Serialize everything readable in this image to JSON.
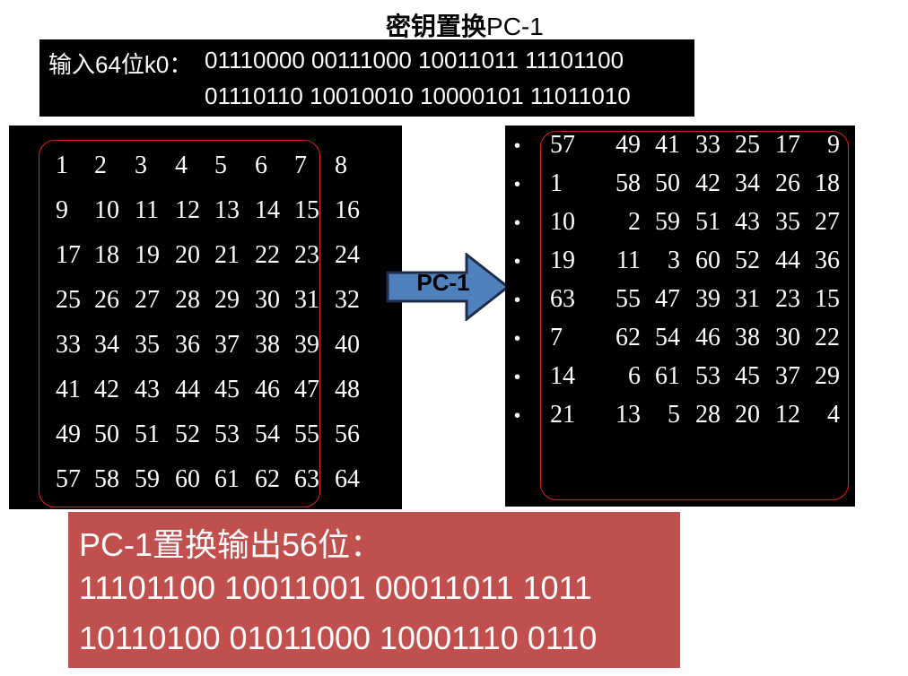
{
  "title": {
    "main": "密钥置换",
    "suffix": "PC-1"
  },
  "input": {
    "label": "输入64位k0：",
    "line1": "01110000 00111000 10011011 11101100",
    "line2": "01110110 10010010 10000101 11011010"
  },
  "left_table": {
    "rows": [
      [
        "1",
        "2",
        "3",
        "4",
        "5",
        "6",
        "7",
        "8"
      ],
      [
        "9",
        "10",
        "11",
        "12",
        "13",
        "14",
        "15",
        "16"
      ],
      [
        "17",
        "18",
        "19",
        "20",
        "21",
        "22",
        "23",
        "24"
      ],
      [
        "25",
        "26",
        "27",
        "28",
        "29",
        "30",
        "31",
        "32"
      ],
      [
        "33",
        "34",
        "35",
        "36",
        "37",
        "38",
        "39",
        "40"
      ],
      [
        "41",
        "42",
        "43",
        "44",
        "45",
        "46",
        "47",
        "48"
      ],
      [
        "49",
        "50",
        "51",
        "52",
        "53",
        "54",
        "55",
        "56"
      ],
      [
        "57",
        "58",
        "59",
        "60",
        "61",
        "62",
        "63",
        "64"
      ]
    ]
  },
  "arrow": {
    "label": "PC-1",
    "color": "#4f81bd"
  },
  "right_table": {
    "bullet": "•",
    "rows": [
      [
        "57",
        "49",
        "41",
        "33",
        "25",
        "17",
        "9"
      ],
      [
        "1",
        "58",
        "50",
        "42",
        "34",
        "26",
        "18"
      ],
      [
        "10",
        "2",
        "59",
        "51",
        "43",
        "35",
        "27"
      ],
      [
        "19",
        "11",
        "3",
        "60",
        "52",
        "44",
        "36"
      ],
      [
        "63",
        "55",
        "47",
        "39",
        "31",
        "23",
        "15"
      ],
      [
        "7",
        "62",
        "54",
        "46",
        "38",
        "30",
        "22"
      ],
      [
        "14",
        "6",
        "61",
        "53",
        "45",
        "37",
        "29"
      ],
      [
        "21",
        "13",
        "5",
        "28",
        "20",
        "12",
        "4"
      ]
    ]
  },
  "output": {
    "title": "PC-1置换输出56位：",
    "line1": "11101100 10011001 00011011 1011",
    "line2": "10110100 01011000 10001110 0110",
    "color": "#c0504d"
  }
}
